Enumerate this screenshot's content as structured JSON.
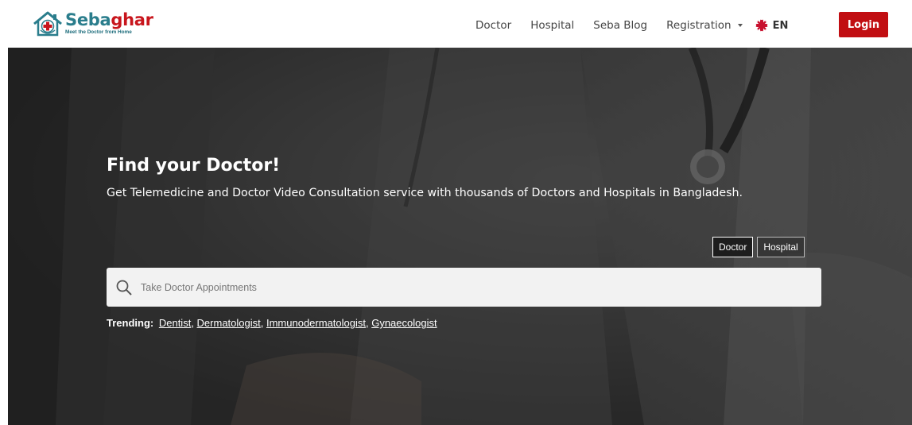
{
  "brand": {
    "name_part1": "Seba",
    "name_part2": "ghar",
    "tagline": "Meet the Doctor from Home"
  },
  "nav": {
    "links": [
      "Doctor",
      "Hospital",
      "Seba Blog",
      "Registration"
    ],
    "language": "EN",
    "login_label": "Login"
  },
  "hero": {
    "title": "Find your Doctor!",
    "subtitle": "Get Telemedicine and Doctor Video Consultation service with thousands of Doctors and Hospitals in Bangladesh.",
    "toggles": [
      {
        "label": "Doctor",
        "active": true
      },
      {
        "label": "Hospital",
        "active": false
      }
    ],
    "search_placeholder": "Take Doctor Appointments",
    "trending_label": "Trending:",
    "trending": [
      "Dentist",
      "Dermatologist",
      "Immunodermatologist",
      "Gynaecologist"
    ]
  },
  "colors": {
    "brand_teal": "#2a7d8c",
    "brand_red": "#c8161d",
    "login_bg": "#c10e12",
    "hero_overlay": "#2e2e2e"
  },
  "icons": [
    "logo-house-icon",
    "caret-down-icon",
    "uk-flag-icon",
    "search-icon"
  ]
}
